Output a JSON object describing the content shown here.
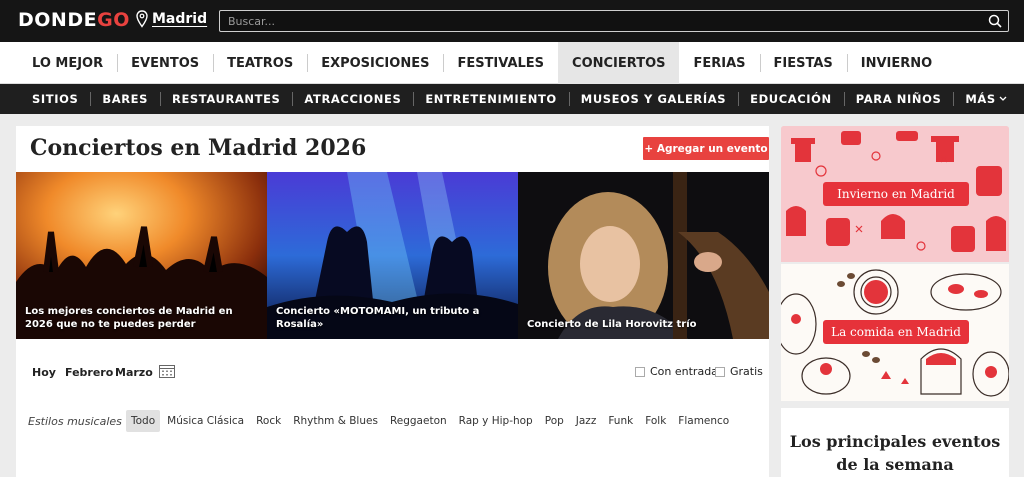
{
  "header": {
    "logo": {
      "part1": "D",
      "part2": "ONDE",
      "part3": "GO"
    },
    "city": "Madrid",
    "search_placeholder": "Buscar..."
  },
  "category_nav": {
    "items": [
      "LO MEJOR",
      "EVENTOS",
      "TEATROS",
      "EXPOSICIONES",
      "FESTIVALES",
      "CONCIERTOS",
      "FERIAS",
      "FIESTAS",
      "INVIERNO"
    ],
    "active": "CONCIERTOS"
  },
  "sub_nav": {
    "items": [
      "SITIOS",
      "BARES",
      "RESTAURANTES",
      "ATRACCIONES",
      "ENTRETENIMIENTO",
      "MUSEOS Y GALERÍAS",
      "EDUCACIÓN",
      "PARA NIÑOS",
      "MÁS"
    ]
  },
  "main": {
    "title": "Conciertos en Madrid 2026",
    "add_event_button": "+ Agregar un evento",
    "cards": [
      {
        "caption": "Los mejores conciertos de Madrid en 2026 que no te puedes perder"
      },
      {
        "caption": "Concierto «MOTOMAMI, un tributo a Rosalía»"
      },
      {
        "caption": "Concierto de Lila Horovitz trío"
      }
    ],
    "date_filters": [
      "Hoy",
      "Febrero",
      "Marzo"
    ],
    "checkboxes": [
      "Con entradas",
      "Gratis"
    ],
    "styles_label": "Estilos musicales",
    "styles": [
      "Todo",
      "Música Clásica",
      "Rock",
      "Rhythm & Blues",
      "Reggaeton",
      "Rap y Hip-hop",
      "Pop",
      "Jazz",
      "Funk",
      "Folk",
      "Flamenco"
    ],
    "styles_active": "Todo"
  },
  "sidebar": {
    "promo1": "Invierno en Madrid",
    "promo2": "La comida en Madrid",
    "week_title": "Los principales eventos de la semana"
  },
  "colors": {
    "accent": "#e8423f",
    "topbar": "#151515",
    "subnav": "#1f1f1f"
  }
}
